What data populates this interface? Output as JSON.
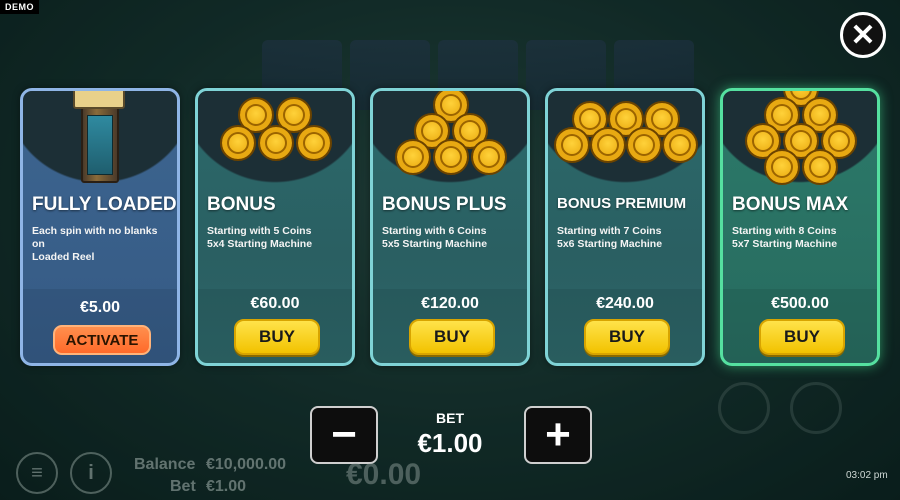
{
  "demo_badge": "DEMO",
  "close_label": "✕",
  "cards": [
    {
      "title": "FULLY LOADED",
      "desc_line1": "Each spin with no blanks on",
      "desc_line2": "Loaded Reel",
      "price": "€5.00",
      "button": "ACTIVATE"
    },
    {
      "title": "BONUS",
      "desc_line1": "Starting with 5 Coins",
      "desc_line2": "5x4 Starting Machine",
      "price": "€60.00",
      "button": "BUY"
    },
    {
      "title": "BONUS PLUS",
      "desc_line1": "Starting with 6 Coins",
      "desc_line2": "5x5 Starting Machine",
      "price": "€120.00",
      "button": "BUY"
    },
    {
      "title": "BONUS PREMIUM",
      "desc_line1": "Starting with 7 Coins",
      "desc_line2": "5x6 Starting Machine",
      "price": "€240.00",
      "button": "BUY"
    },
    {
      "title": "BONUS MAX",
      "desc_line1": "Starting with 8 Coins",
      "desc_line2": "5x7 Starting Machine",
      "price": "€500.00",
      "button": "BUY"
    }
  ],
  "bet": {
    "label": "BET",
    "value": "€1.00",
    "minus": "−",
    "plus": "+"
  },
  "footer": {
    "balance_label": "Balance",
    "balance_value": "€10,000.00",
    "bet_label": "Bet",
    "bet_value": "€1.00",
    "win_value": "€0.00",
    "clock": "03:02 pm",
    "info_icon": "i"
  },
  "colors": {
    "buy": "#f2c200",
    "activate": "#ff6a2a",
    "max_border": "#55e0a0"
  }
}
